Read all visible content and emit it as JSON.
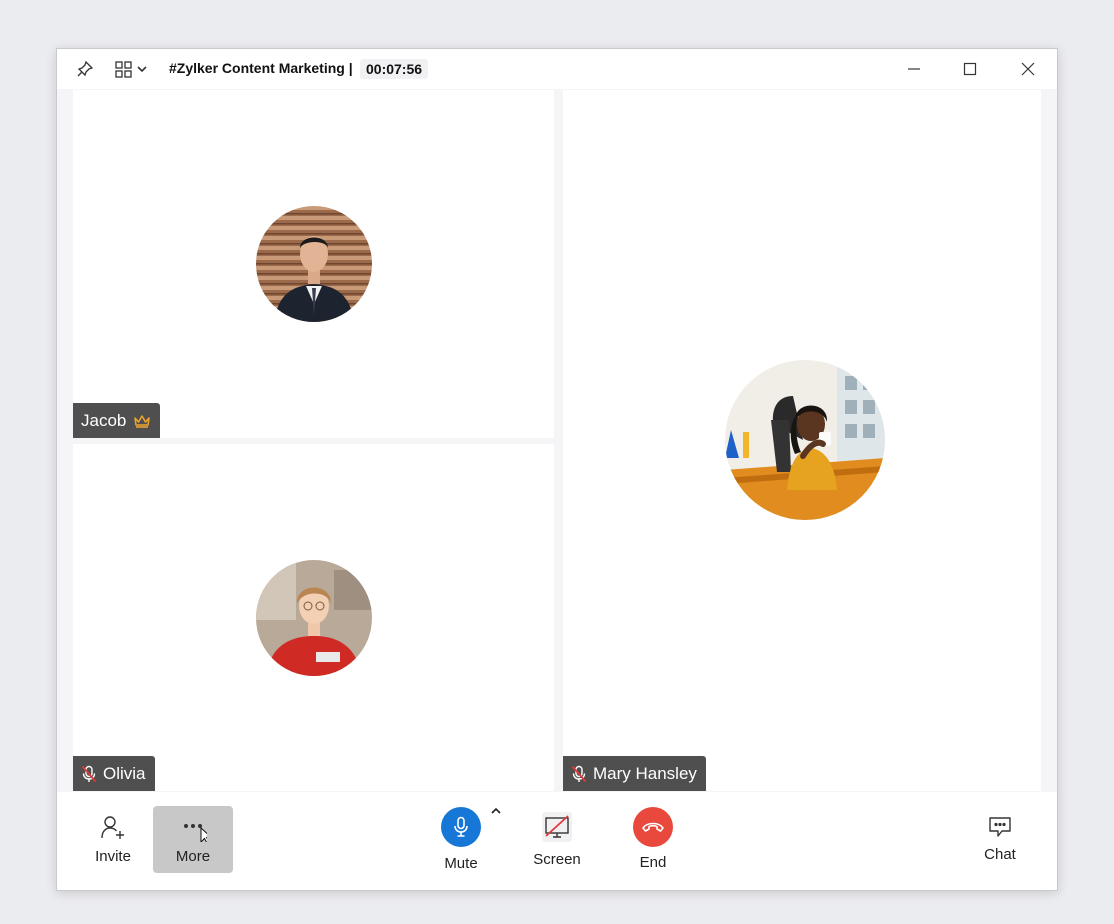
{
  "window": {
    "title": "#Zylker Content Marketing |",
    "timer": "00:07:56"
  },
  "icons": {
    "pin": "pin-icon",
    "layout": "grid-layout-icon",
    "minimize": "minimize-icon",
    "maximize": "maximize-icon",
    "close": "close-icon"
  },
  "participants": [
    {
      "name": "Jacob",
      "host": true,
      "muted": false
    },
    {
      "name": "Olivia",
      "host": false,
      "muted": true
    },
    {
      "name": "Mary Hansley",
      "host": false,
      "muted": true
    }
  ],
  "toolbar": {
    "invite_label": "Invite",
    "more_label": "More",
    "mute_label": "Mute",
    "screen_label": "Screen",
    "end_label": "End",
    "chat_label": "Chat"
  },
  "colors": {
    "mute_button": "#1677d6",
    "end_button": "#e8493c",
    "crown": "#f0a62b",
    "muted_mic": "#e03a3a"
  }
}
